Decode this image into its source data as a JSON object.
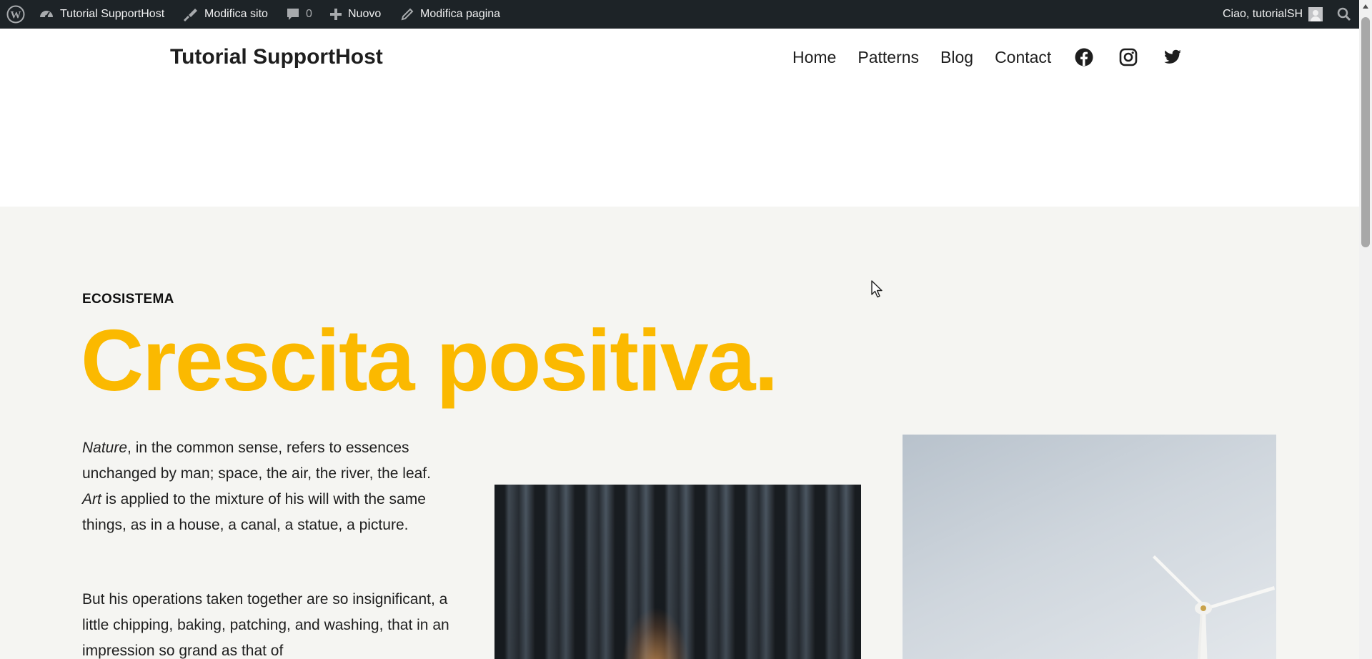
{
  "admin_bar": {
    "site_name": "Tutorial SupportHost",
    "edit_site": "Modifica sito",
    "comments_count": "0",
    "new_label": "Nuovo",
    "edit_page": "Modifica pagina",
    "greeting": "Ciao, tutorialSH",
    "icons": [
      "wordpress-logo-icon",
      "dashboard-icon",
      "brush-icon",
      "comment-icon",
      "plus-icon",
      "pencil-icon",
      "avatar",
      "search-icon"
    ]
  },
  "header": {
    "site_title": "Tutorial SupportHost",
    "nav": [
      {
        "label": "Home"
      },
      {
        "label": "Patterns"
      },
      {
        "label": "Blog"
      },
      {
        "label": "Contact"
      }
    ],
    "social_icons": [
      "facebook-icon",
      "instagram-icon",
      "twitter-icon"
    ]
  },
  "hero": {
    "eyebrow": "ECOSISTEMA",
    "headline": "Crescita positiva.",
    "para1": {
      "nature": "Nature",
      "part1": ", in the common sense, refers to essences unchanged by man; space, the air, the river, the leaf. ",
      "art": "Art",
      "part2": " is applied to the mixture of his will with the same things, as in a house, a canal, a statue, a picture."
    },
    "para2": "But his operations taken together are so insignificant, a little chipping, baking, patching, and washing, that in an impression so grand as that of",
    "background": "#f5f5f2",
    "accent_color": "#fbb900"
  }
}
